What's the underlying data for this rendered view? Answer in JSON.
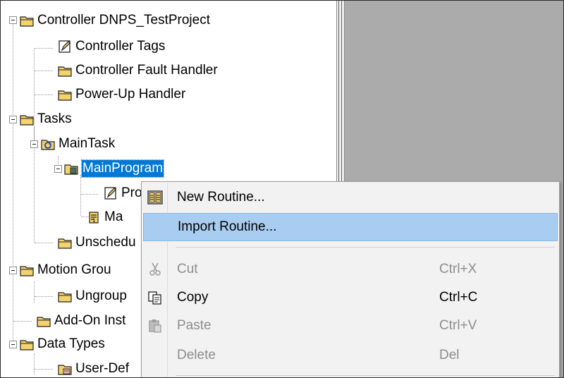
{
  "tree": {
    "items": [
      {
        "label": "Controller DNPS_TestProject",
        "icon": "folder-icon"
      },
      {
        "label": "Controller Tags",
        "icon": "tags-icon"
      },
      {
        "label": "Controller Fault Handler",
        "icon": "folder-icon"
      },
      {
        "label": "Power-Up Handler",
        "icon": "folder-icon"
      },
      {
        "label": "Tasks",
        "icon": "folder-icon"
      },
      {
        "label": "MainTask",
        "icon": "task-icon"
      },
      {
        "label": "MainProgram",
        "icon": "program-icon"
      },
      {
        "label": "Pro",
        "icon": "tags-icon"
      },
      {
        "label": "Ma",
        "icon": "routine-icon"
      },
      {
        "label": "Unschedu",
        "icon": "folder-icon"
      },
      {
        "label": "Motion Grou",
        "icon": "folder-icon"
      },
      {
        "label": "Ungroup",
        "icon": "folder-icon"
      },
      {
        "label": "Add-On Inst",
        "icon": "folder-icon"
      },
      {
        "label": "Data Types",
        "icon": "folder-icon"
      },
      {
        "label": "User-Def",
        "icon": "datatype-icon"
      }
    ],
    "selected": "MainProgram"
  },
  "context_menu": {
    "items": [
      {
        "label": "New Routine...",
        "shortcut": "",
        "icon": "new-routine-icon",
        "enabled": true
      },
      {
        "label": "Import Routine...",
        "shortcut": "",
        "icon": "",
        "enabled": true,
        "highlighted": true
      },
      {
        "label": "Cut",
        "shortcut": "Ctrl+X",
        "icon": "cut-icon",
        "enabled": false
      },
      {
        "label": "Copy",
        "shortcut": "Ctrl+C",
        "icon": "copy-icon",
        "enabled": true
      },
      {
        "label": "Paste",
        "shortcut": "Ctrl+V",
        "icon": "paste-icon",
        "enabled": false
      },
      {
        "label": "Delete",
        "shortcut": "Del",
        "icon": "",
        "enabled": false
      }
    ]
  },
  "colors": {
    "selection": "#0078d7",
    "menu_highlight": "#a8cdf0",
    "workspace": "#ababab",
    "folder": "#f5d36b"
  }
}
